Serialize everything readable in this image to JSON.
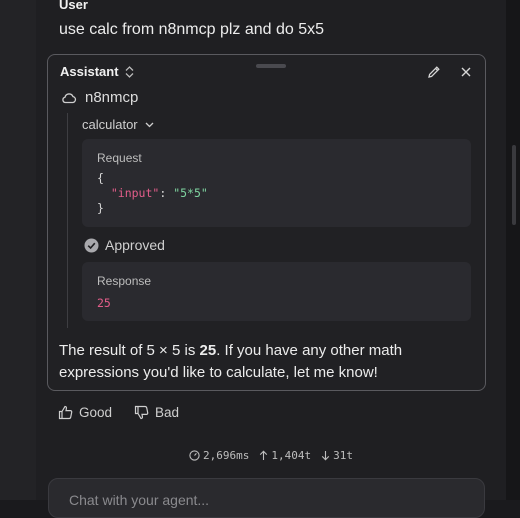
{
  "user": {
    "label": "User",
    "message": "use calc from n8nmcp plz and do 5x5"
  },
  "assistant": {
    "label": "Assistant",
    "server_name": "n8nmcp",
    "tool_name": "calculator",
    "request": {
      "label": "Request",
      "open_brace": "{",
      "key": "\"input\"",
      "colon": ": ",
      "value": "\"5*5\"",
      "close_brace": "}"
    },
    "status": "Approved",
    "response": {
      "label": "Response",
      "value": "25"
    },
    "answer": {
      "before": "The result of 5 × 5 is ",
      "bold": "25",
      "after": ". If you have any other math expressions you'd like to calculate, let me know!"
    }
  },
  "feedback": {
    "good_label": "Good",
    "bad_label": "Bad"
  },
  "stats": {
    "duration": "2,696ms",
    "tokens_in": "1,404t",
    "tokens_out": "31t"
  },
  "chat_input": {
    "placeholder": "Chat with your agent..."
  },
  "colors": {
    "background": "#1f1f22",
    "card_border": "#5a5a5f",
    "code_key": "#e35d8a",
    "code_string": "#7fd4a0"
  },
  "icons": [
    "chevron-up-down-icon",
    "pencil-icon",
    "close-icon",
    "cloud-icon",
    "chevron-down-icon",
    "check-circle-icon",
    "thumbs-up-icon",
    "thumbs-down-icon",
    "timer-icon",
    "arrow-up-icon",
    "arrow-down-icon"
  ]
}
